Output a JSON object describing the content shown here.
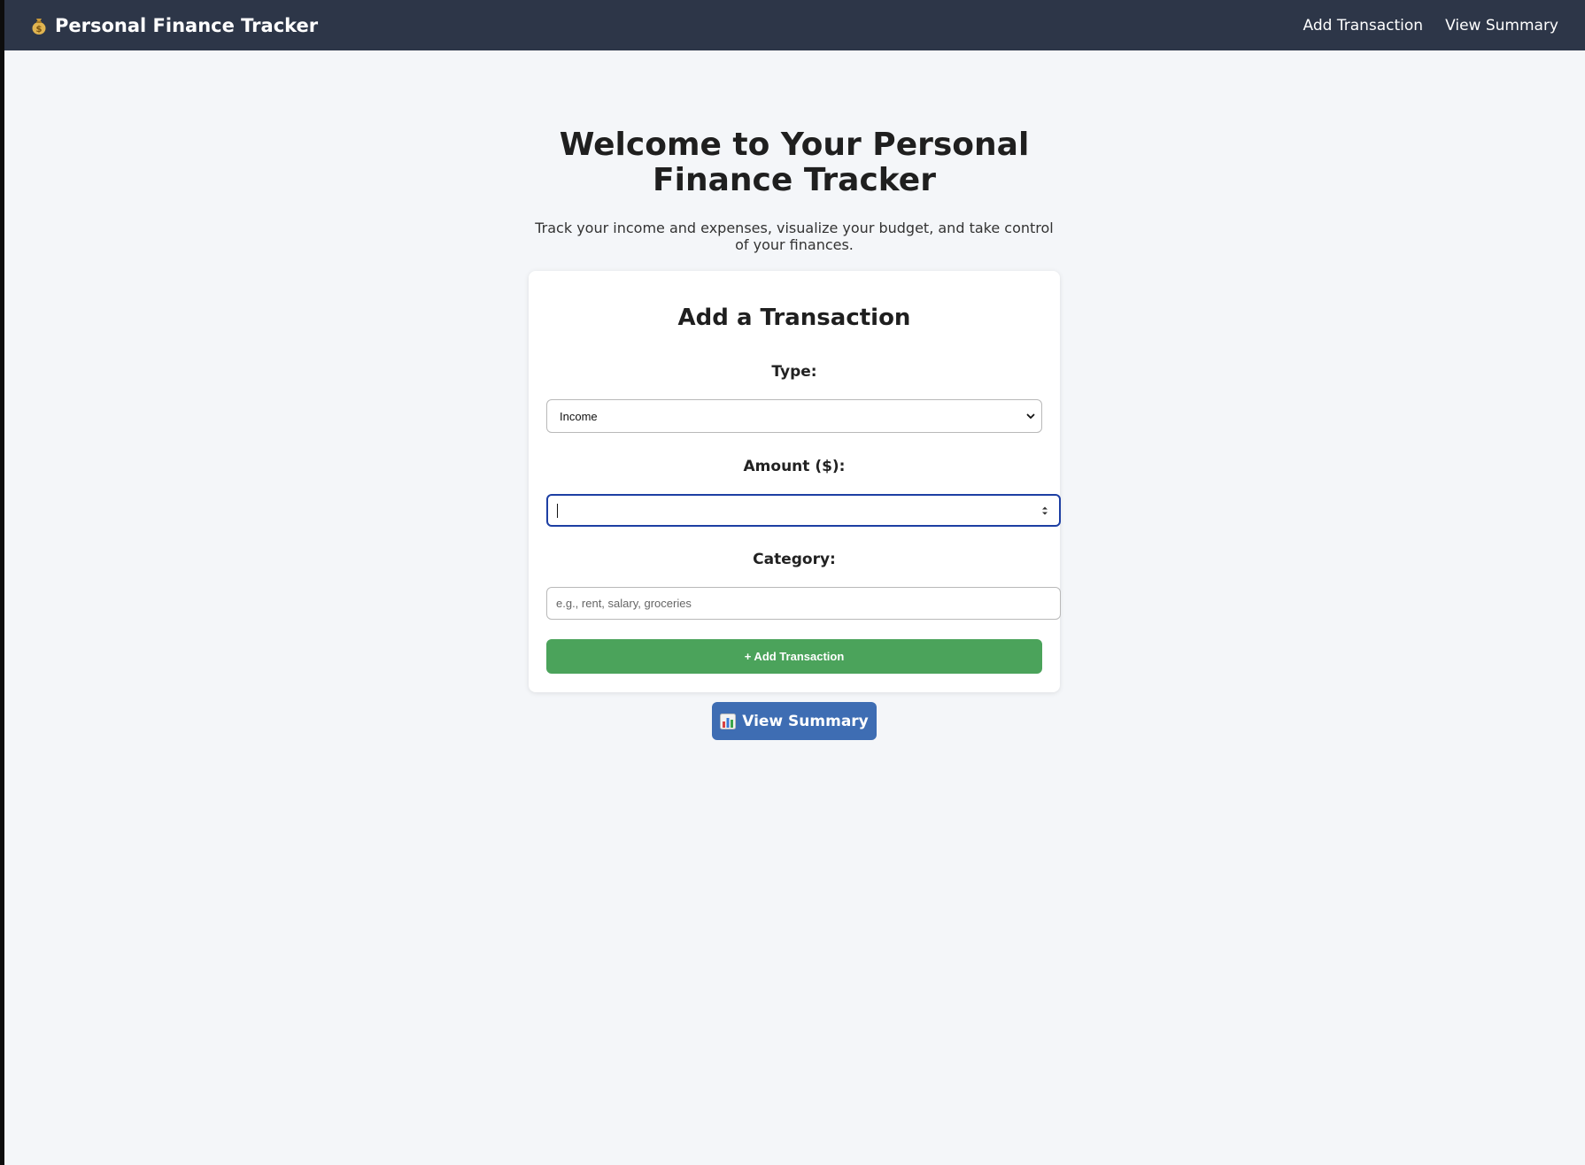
{
  "nav": {
    "brand": "Personal Finance Tracker",
    "brand_icon": "money-bag-icon",
    "links": [
      "Add Transaction",
      "View Summary"
    ]
  },
  "hero": {
    "title": "Welcome to Your Personal Finance Tracker",
    "subtitle": "Track your income and expenses, visualize your budget, and take control of your finances."
  },
  "form": {
    "heading": "Add a Transaction",
    "type_label": "Type:",
    "type_selected": "Income",
    "amount_label": "Amount ($):",
    "amount_value": "",
    "category_label": "Category:",
    "category_placeholder": "e.g., rent, salary, groceries",
    "submit_label": "+ Add Transaction"
  },
  "summary_button": {
    "label": "View Summary",
    "icon": "bar-chart-icon"
  },
  "colors": {
    "navbar": "#2d3648",
    "background": "#f4f6f9",
    "add_button": "#4ba35b",
    "summary_button": "#3e6db3",
    "focus_border": "#1d3fa3"
  }
}
